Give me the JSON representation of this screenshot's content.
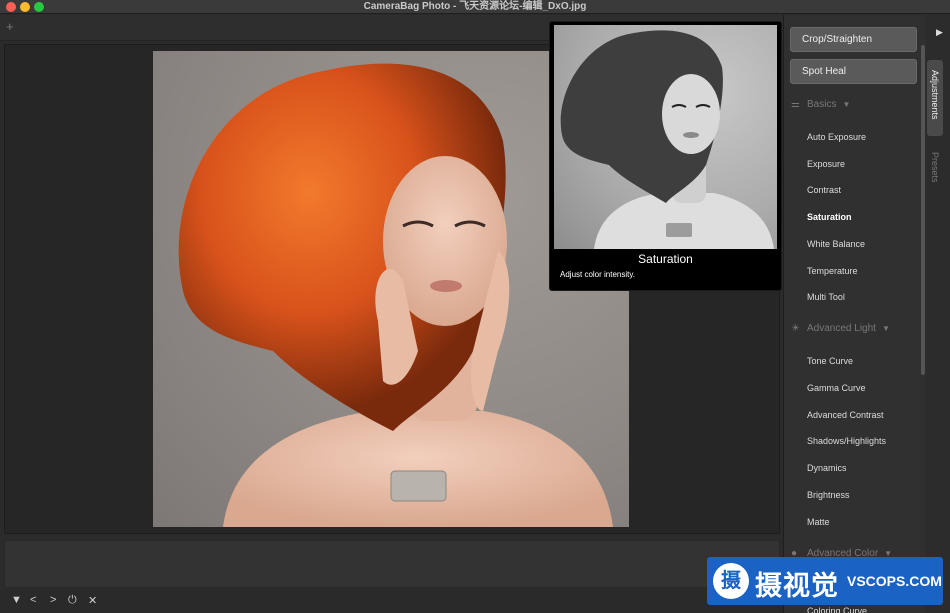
{
  "window": {
    "title": "CameraBag Photo - 飞天资源论坛-编辑_DxO.jpg"
  },
  "toolbar": {
    "add_icon": "plus-icon",
    "add_label": "+"
  },
  "tools": {
    "crop_label": "Crop/Straighten",
    "spot_heal_label": "Spot Heal"
  },
  "sections": {
    "basics": {
      "label": "Basics",
      "icon": "sliders-icon",
      "items": [
        "Auto Exposure",
        "Exposure",
        "Contrast",
        "Saturation",
        "White Balance",
        "Temperature",
        "Multi Tool"
      ]
    },
    "advanced_light": {
      "label": "Advanced Light",
      "icon": "sun-icon",
      "items": [
        "Tone Curve",
        "Gamma Curve",
        "Advanced Contrast",
        "Shadows/Highlights",
        "Dynamics",
        "Brightness",
        "Matte"
      ]
    },
    "advanced_color": {
      "label": "Advanced Color",
      "icon": "droplet-icon",
      "items": [
        "Coloring Curve"
      ]
    }
  },
  "active_item": "Saturation",
  "side_tabs": {
    "adjustments": "Adjustments",
    "presets": "Presets"
  },
  "tooltip": {
    "title": "Saturation",
    "description": "Adjust color intensity."
  },
  "bottom_bar": {
    "icons": [
      "triangle-down-icon",
      "chevron-left-icon",
      "chevron-right-icon",
      "power-icon",
      "close-icon"
    ],
    "glyphs": [
      "▼",
      "<",
      ">",
      "⏻",
      "✕"
    ]
  },
  "watermark": {
    "logo_glyph": "摄",
    "chinese": "摄视觉",
    "english": "VSCOPS.COM"
  },
  "colors": {
    "accent_hair": "#d8521b",
    "watermark_bg": "#1a62c4",
    "panel_bg": "#303030"
  }
}
